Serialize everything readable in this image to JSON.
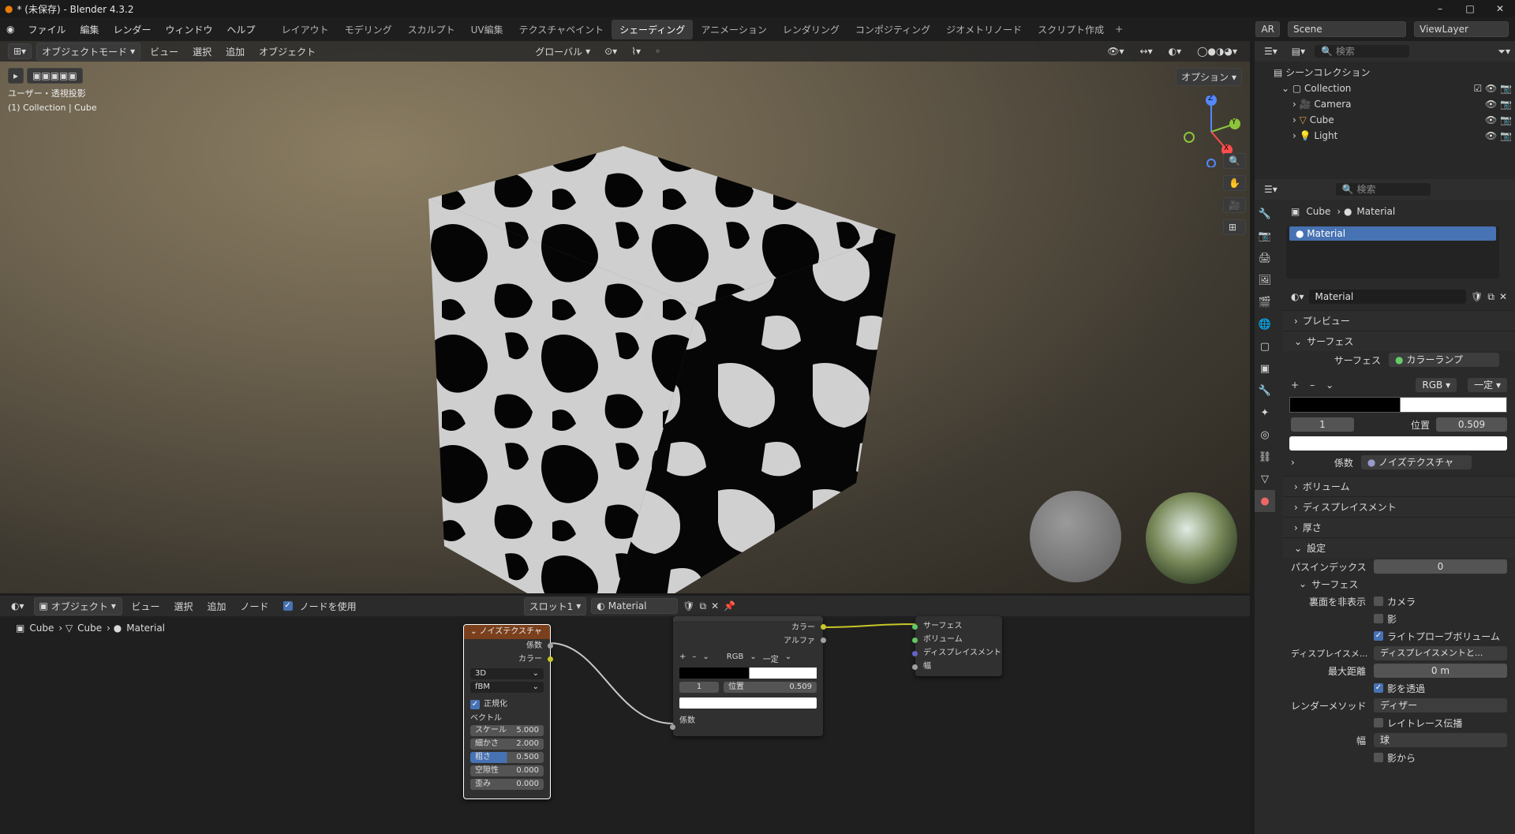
{
  "titlebar": {
    "title": "* (未保存) - Blender 4.3.2",
    "min": "–",
    "max": "□",
    "close": "✕"
  },
  "menu": [
    "ファイル",
    "編集",
    "レンダー",
    "ウィンドウ",
    "ヘルプ"
  ],
  "workspaces": [
    "レイアウト",
    "モデリング",
    "スカルプト",
    "UV編集",
    "テクスチャペイント",
    "シェーディング",
    "アニメーション",
    "レンダリング",
    "コンポジティング",
    "ジオメトリノード",
    "スクリプト作成"
  ],
  "active_workspace": "シェーディング",
  "topright": {
    "ar": "AR",
    "scene": "Scene",
    "viewlayer": "ViewLayer"
  },
  "viewport": {
    "mode": "オブジェクトモード",
    "menus": [
      "ビュー",
      "選択",
      "追加",
      "オブジェクト"
    ],
    "orientation": "グローバル",
    "options": "オプション",
    "view_name": "ユーザー・透視投影",
    "collection_info": "(1) Collection | Cube",
    "gizmo": {
      "z": "Z",
      "y": "Y",
      "x": "X"
    }
  },
  "outliner": {
    "search": "検索",
    "root": "シーンコレクション",
    "collection": "Collection",
    "items": [
      "Camera",
      "Cube",
      "Light"
    ]
  },
  "props": {
    "search": "検索",
    "breadcrumb": [
      "Cube",
      "Material"
    ],
    "slot": "Material",
    "material_name": "Material",
    "sections": {
      "preview": "プレビュー",
      "surface": "サーフェス",
      "volume": "ボリューム",
      "displacement": "ディスプレイスメント",
      "thickness": "厚さ",
      "settings": "設定"
    },
    "surface_label": "サーフェス",
    "surface_value": "カラーランプ",
    "ramp": {
      "mode": "RGB",
      "interp": "一定",
      "index": "1",
      "pos_label": "位置",
      "pos": "0.509"
    },
    "fac_label": "係数",
    "fac_value": "ノイズテクスチャ",
    "settings": {
      "pass_label": "パスインデックス",
      "pass": "0",
      "sub": "サーフェス",
      "backface": "裏面を非表示",
      "camera": "カメラ",
      "shadow": "影",
      "lightprobe": "ライトプローブボリューム",
      "disp_label": "ディスプレイスメ...",
      "disp_value": "ディスプレイスメントと...",
      "maxdist_label": "最大距離",
      "maxdist": "0 m",
      "transparent_shadow": "影を透過",
      "render_label": "レンダーメソッド",
      "render_value": "ディザー",
      "raytrace": "レイトレース伝播",
      "width_label": "幅",
      "width_value": "球",
      "from_shadow": "影から"
    }
  },
  "nodeeditor": {
    "type": "オブジェクト",
    "menus": [
      "ビュー",
      "選択",
      "追加",
      "ノード"
    ],
    "use_nodes": "ノードを使用",
    "slot": "スロット1",
    "material": "Material",
    "breadcrumb": [
      "Cube",
      "Cube",
      "Material"
    ],
    "noise": {
      "title": "ノイズテクスチャ",
      "out_fac": "係数",
      "out_color": "カラー",
      "dim": "3D",
      "type": "fBM",
      "normalize": "正規化",
      "vector": "ベクトル",
      "params": [
        {
          "k": "スケール",
          "v": "5.000"
        },
        {
          "k": "細かさ",
          "v": "2.000"
        },
        {
          "k": "粗さ",
          "v": "0.500"
        },
        {
          "k": "空隙性",
          "v": "0.000"
        },
        {
          "k": "歪み",
          "v": "0.000"
        }
      ]
    },
    "ramp": {
      "out_color": "カラー",
      "out_alpha": "アルファ",
      "mode": "RGB",
      "interp": "一定",
      "index": "1",
      "pos_label": "位置",
      "pos": "0.509",
      "in_fac": "係数"
    },
    "output": {
      "surface": "サーフェス",
      "volume": "ボリューム",
      "displacement": "ディスプレイスメント",
      "width": "幅"
    }
  }
}
